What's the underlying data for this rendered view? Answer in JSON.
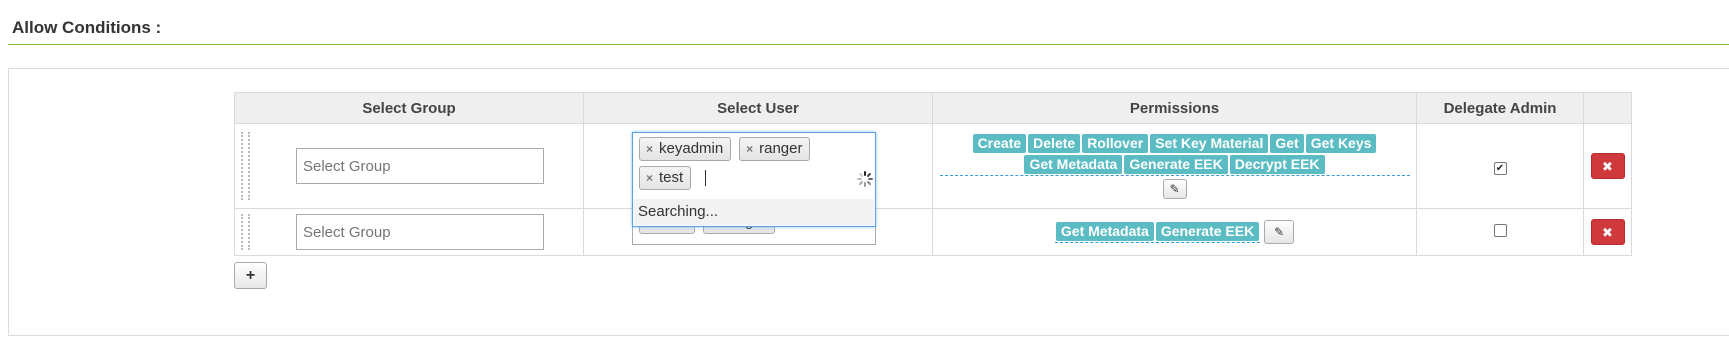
{
  "section": {
    "title": "Allow Conditions :"
  },
  "table": {
    "headers": {
      "group": "Select Group",
      "user": "Select User",
      "permissions": "Permissions",
      "delegate": "Delegate Admin"
    },
    "rows": [
      {
        "group_placeholder": "Select Group",
        "users": [
          "keyadmin",
          "ranger",
          "test"
        ],
        "dropdown_status": "Searching...",
        "permissions": [
          "Create",
          "Delete",
          "Rollover",
          "Set Key Material",
          "Get",
          "Get Keys",
          "Get Metadata",
          "Generate EEK",
          "Decrypt EEK"
        ],
        "delegate_admin": true
      },
      {
        "group_placeholder": "Select Group",
        "users": [
          "hdfs",
          "ranger"
        ],
        "permissions": [
          "Get Metadata",
          "Generate EEK"
        ],
        "delegate_admin": false
      }
    ]
  },
  "icons": {
    "remove_tag": "times-icon",
    "edit": "pencil-icon",
    "delete": "times-icon",
    "add": "plus-icon",
    "loading": "spinner-icon"
  },
  "colors": {
    "accent_rule": "#8db83a",
    "permission_tag": "#5bbcc4",
    "delete_button": "#d0393c",
    "focus_border": "#5ba3e0"
  },
  "glyphs": {
    "remove": "×",
    "delete": "✖",
    "add": "+",
    "edit": "✎",
    "check": "✔"
  }
}
